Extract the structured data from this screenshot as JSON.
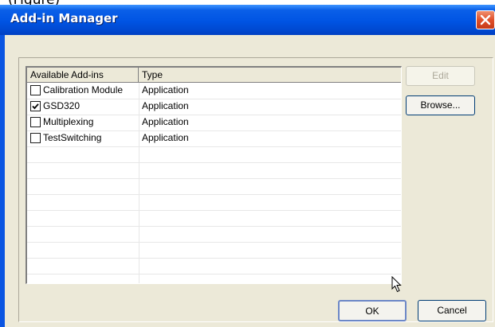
{
  "page_fragment": "(Figure)",
  "window": {
    "title": "Add-in Manager",
    "titlebar_color": "#0054e3",
    "close_color": "#e0502a"
  },
  "list": {
    "columns": [
      "Available Add-ins",
      "Type"
    ],
    "rows": [
      {
        "name": "Calibration Module",
        "type": "Application",
        "checked": false
      },
      {
        "name": "GSD320",
        "type": "Application",
        "checked": true
      },
      {
        "name": "Multiplexing",
        "type": "Application",
        "checked": false
      },
      {
        "name": "TestSwitching",
        "type": "Application",
        "checked": false
      }
    ]
  },
  "buttons": {
    "edit": "Edit",
    "browse": "Browse...",
    "ok": "OK",
    "cancel": "Cancel"
  }
}
